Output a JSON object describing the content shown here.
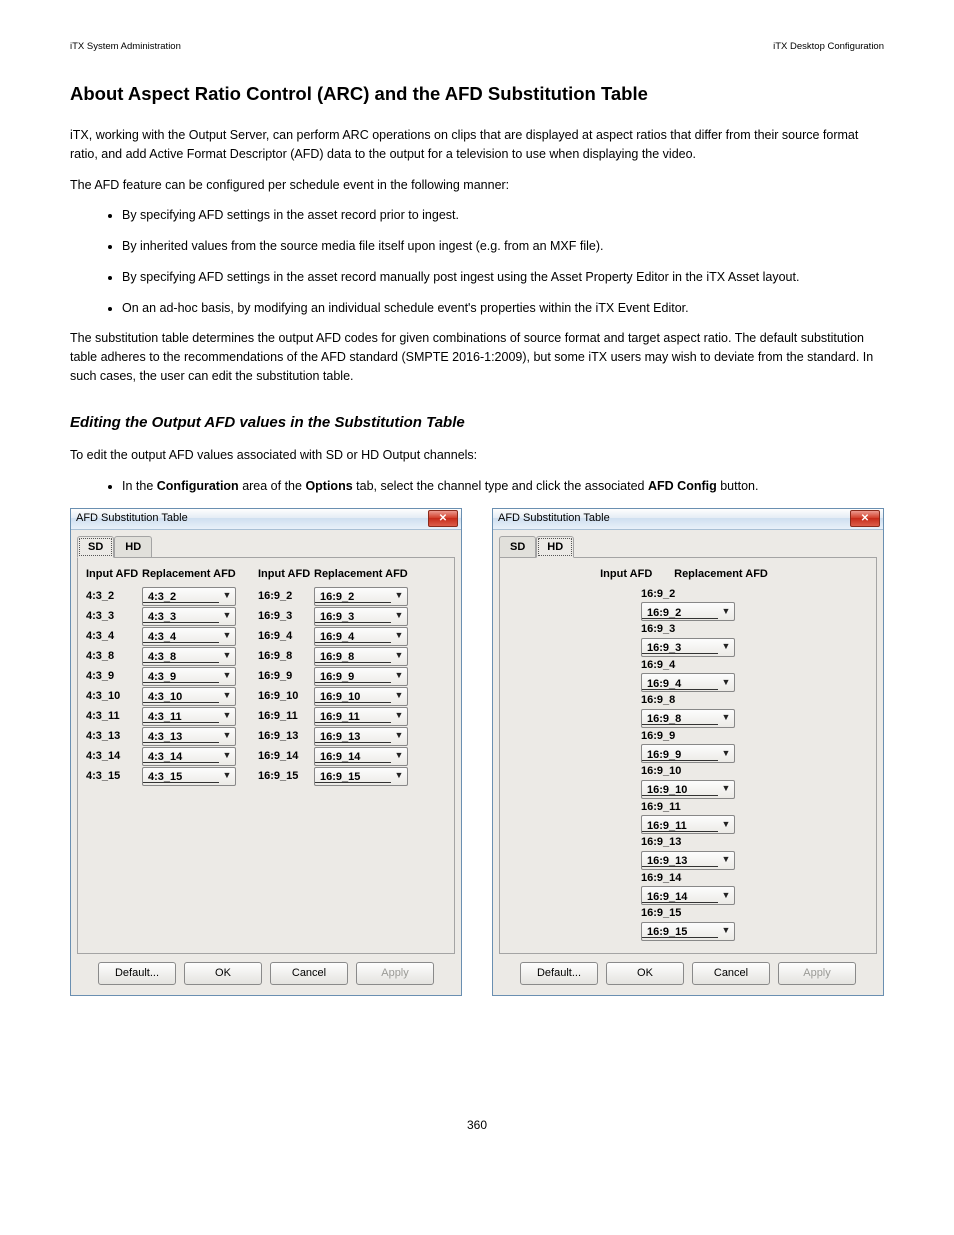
{
  "header": {
    "left": "iTX System Administration",
    "right": "iTX Desktop Configuration"
  },
  "title": "About Aspect Ratio Control (ARC) and the AFD Substitution Table",
  "intro1": "iTX, working with the Output Server, can perform ARC operations on clips that are displayed at aspect ratios that differ from their source format ratio, and add Active Format Descriptor (AFD) data to the output for a television to use when displaying the video.",
  "intro2": "The AFD feature can be configured per schedule event in the following manner:",
  "bullets": [
    "By specifying AFD settings in the asset record prior to ingest.",
    "By inherited values from the source media file itself upon ingest (e.g. from an MXF file).",
    "By specifying AFD settings in the asset record manually post ingest using the Asset Property Editor in the iTX Asset layout.",
    "On an ad-hoc basis, by modifying an individual schedule event's properties within the iTX Event Editor."
  ],
  "para3": "The substitution table determines the output AFD codes for given combinations of source format and target aspect ratio. The default substitution table adheres to the recommendations of the AFD standard (SMPTE 2016-1:2009), but some iTX users may wish to deviate from the standard. In such cases, the user can edit the substitution table.",
  "subhead": "Editing the Output AFD values in the Substitution Table",
  "subintro": "To edit the output AFD values associated with SD or HD Output channels:",
  "step1_pre": "In the",
  "step1_cfg": "Configuration",
  "step1_mid": "area of the",
  "step1_opt": "Options",
  "step1_mid2": "tab, select the channel type and click the associated",
  "step1_btn": "AFD Config",
  "step1_post": "button.",
  "dialogs": {
    "title": "AFD Substitution Table",
    "tabs": {
      "sd": "SD",
      "hd": "HD"
    },
    "headers": {
      "input": "Input AFD",
      "replacement": "Replacement AFD"
    },
    "sd": {
      "left": [
        {
          "in": "4:3_2",
          "rep": "4:3_2"
        },
        {
          "in": "4:3_3",
          "rep": "4:3_3"
        },
        {
          "in": "4:3_4",
          "rep": "4:3_4"
        },
        {
          "in": "4:3_8",
          "rep": "4:3_8"
        },
        {
          "in": "4:3_9",
          "rep": "4:3_9"
        },
        {
          "in": "4:3_10",
          "rep": "4:3_10"
        },
        {
          "in": "4:3_11",
          "rep": "4:3_11"
        },
        {
          "in": "4:3_13",
          "rep": "4:3_13"
        },
        {
          "in": "4:3_14",
          "rep": "4:3_14"
        },
        {
          "in": "4:3_15",
          "rep": "4:3_15"
        }
      ],
      "right": [
        {
          "in": "16:9_2",
          "rep": "16:9_2"
        },
        {
          "in": "16:9_3",
          "rep": "16:9_3"
        },
        {
          "in": "16:9_4",
          "rep": "16:9_4"
        },
        {
          "in": "16:9_8",
          "rep": "16:9_8"
        },
        {
          "in": "16:9_9",
          "rep": "16:9_9"
        },
        {
          "in": "16:9_10",
          "rep": "16:9_10"
        },
        {
          "in": "16:9_11",
          "rep": "16:9_11"
        },
        {
          "in": "16:9_13",
          "rep": "16:9_13"
        },
        {
          "in": "16:9_14",
          "rep": "16:9_14"
        },
        {
          "in": "16:9_15",
          "rep": "16:9_15"
        }
      ]
    },
    "hd": {
      "rows": [
        {
          "in": "16:9_2",
          "rep": "16:9_2"
        },
        {
          "in": "16:9_3",
          "rep": "16:9_3"
        },
        {
          "in": "16:9_4",
          "rep": "16:9_4"
        },
        {
          "in": "16:9_8",
          "rep": "16:9_8"
        },
        {
          "in": "16:9_9",
          "rep": "16:9_9"
        },
        {
          "in": "16:9_10",
          "rep": "16:9_10"
        },
        {
          "in": "16:9_11",
          "rep": "16:9_11"
        },
        {
          "in": "16:9_13",
          "rep": "16:9_13"
        },
        {
          "in": "16:9_14",
          "rep": "16:9_14"
        },
        {
          "in": "16:9_15",
          "rep": "16:9_15"
        }
      ]
    },
    "buttons": {
      "default": "Default...",
      "ok": "OK",
      "cancel": "Cancel",
      "apply": "Apply"
    }
  },
  "page_number": "360"
}
